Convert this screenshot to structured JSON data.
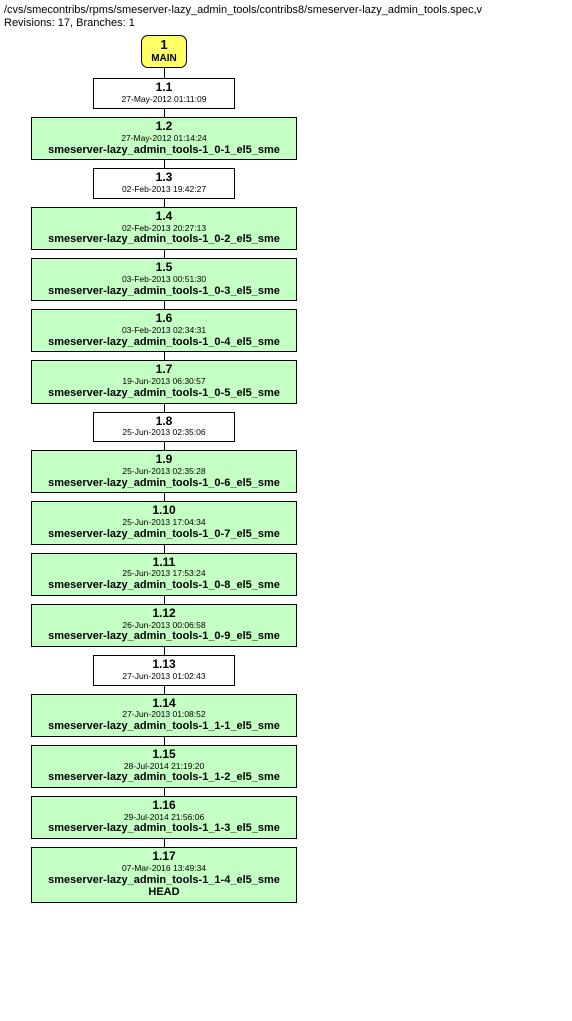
{
  "header": {
    "path": "/cvs/smecontribs/rpms/smeserver-lazy_admin_tools/contribs8/smeserver-lazy_admin_tools.spec,v",
    "meta": "Revisions: 17, Branches: 1"
  },
  "branch": {
    "num": "1",
    "label": "MAIN"
  },
  "nodes": [
    {
      "ver": "1.1",
      "date": "27-May-2012 01:11:09",
      "tag": "",
      "cls": "small",
      "bg": "plain"
    },
    {
      "ver": "1.2",
      "date": "27-May-2012 01:14:24",
      "tag": "smeserver-lazy_admin_tools-1_0-1_el5_sme",
      "cls": "wide",
      "bg": "green"
    },
    {
      "ver": "1.3",
      "date": "02-Feb-2013 19:42:27",
      "tag": "",
      "cls": "small",
      "bg": "plain"
    },
    {
      "ver": "1.4",
      "date": "02-Feb-2013 20:27:13",
      "tag": "smeserver-lazy_admin_tools-1_0-2_el5_sme",
      "cls": "wide",
      "bg": "green"
    },
    {
      "ver": "1.5",
      "date": "03-Feb-2013 00:51:30",
      "tag": "smeserver-lazy_admin_tools-1_0-3_el5_sme",
      "cls": "wide",
      "bg": "green"
    },
    {
      "ver": "1.6",
      "date": "03-Feb-2013 02:34:31",
      "tag": "smeserver-lazy_admin_tools-1_0-4_el5_sme",
      "cls": "wide",
      "bg": "green"
    },
    {
      "ver": "1.7",
      "date": "19-Jun-2013 06:30:57",
      "tag": "smeserver-lazy_admin_tools-1_0-5_el5_sme",
      "cls": "wide",
      "bg": "green"
    },
    {
      "ver": "1.8",
      "date": "25-Jun-2013 02:35:06",
      "tag": "",
      "cls": "small",
      "bg": "plain"
    },
    {
      "ver": "1.9",
      "date": "25-Jun-2013 02:35:28",
      "tag": "smeserver-lazy_admin_tools-1_0-6_el5_sme",
      "cls": "wide",
      "bg": "green"
    },
    {
      "ver": "1.10",
      "date": "25-Jun-2013 17:04:34",
      "tag": "smeserver-lazy_admin_tools-1_0-7_el5_sme",
      "cls": "wide",
      "bg": "green"
    },
    {
      "ver": "1.11",
      "date": "25-Jun-2013 17:53:24",
      "tag": "smeserver-lazy_admin_tools-1_0-8_el5_sme",
      "cls": "wide",
      "bg": "green"
    },
    {
      "ver": "1.12",
      "date": "26-Jun-2013 00:06:58",
      "tag": "smeserver-lazy_admin_tools-1_0-9_el5_sme",
      "cls": "wide",
      "bg": "green"
    },
    {
      "ver": "1.13",
      "date": "27-Jun-2013 01:02:43",
      "tag": "",
      "cls": "small",
      "bg": "plain"
    },
    {
      "ver": "1.14",
      "date": "27-Jun-2013 01:08:52",
      "tag": "smeserver-lazy_admin_tools-1_1-1_el5_sme",
      "cls": "wide",
      "bg": "green"
    },
    {
      "ver": "1.15",
      "date": "28-Jul-2014 21:19:20",
      "tag": "smeserver-lazy_admin_tools-1_1-2_el5_sme",
      "cls": "wide",
      "bg": "green"
    },
    {
      "ver": "1.16",
      "date": "29-Jul-2014 21:56:06",
      "tag": "smeserver-lazy_admin_tools-1_1-3_el5_sme",
      "cls": "wide",
      "bg": "green"
    },
    {
      "ver": "1.17",
      "date": "07-Mar-2016 13:49:34",
      "tag": "smeserver-lazy_admin_tools-1_1-4_el5_sme",
      "cls": "wide",
      "bg": "green",
      "extra": "HEAD"
    }
  ]
}
